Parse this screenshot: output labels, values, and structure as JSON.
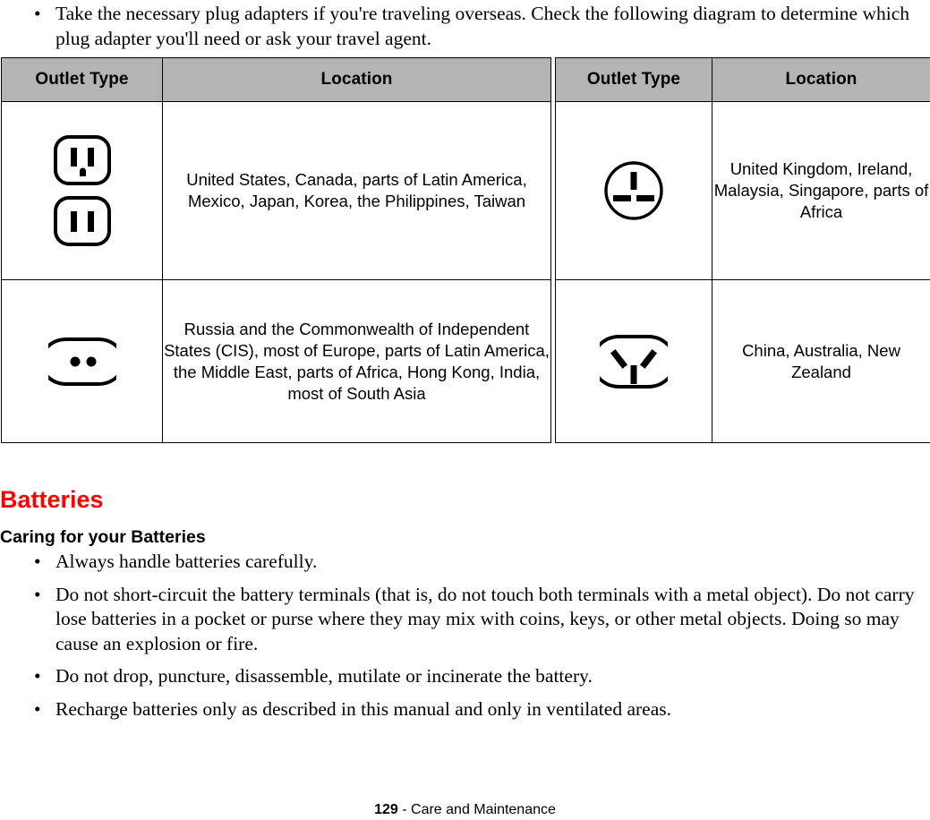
{
  "intro": {
    "bullets": [
      "Take the necessary plug adapters if you're traveling overseas. Check the following diagram to determine which plug adapter you'll need or ask your travel agent."
    ]
  },
  "outlet_table_left": {
    "headers": [
      "Outlet Type",
      "Location"
    ],
    "rows": [
      {
        "icon": "us-outlet-icon",
        "location": "United States, Canada, parts of Latin America, Mexico, Japan, Korea, the Philippines, Taiwan"
      },
      {
        "icon": "europlug-outlet-icon",
        "location": "Russia and the Commonwealth of Independent States (CIS), most of Europe, parts of Latin America, the Middle East, parts of Africa, Hong Kong, India, most of South Asia"
      }
    ]
  },
  "outlet_table_right": {
    "headers": [
      "Outlet Type",
      "Location"
    ],
    "rows": [
      {
        "icon": "uk-outlet-icon",
        "location": "United Kingdom, Ireland, Malaysia, Singapore, parts of Africa"
      },
      {
        "icon": "au-outlet-icon",
        "location": "China, Australia, New Zealand"
      }
    ]
  },
  "batteries": {
    "heading": "Batteries",
    "subheading": "Caring for your Batteries",
    "bullets": [
      "Always handle batteries carefully.",
      "Do not short-circuit the battery terminals (that is, do not touch both terminals with a metal object). Do not carry lose batteries in a pocket or purse where they may mix with coins, keys, or other metal objects. Doing so may cause an explosion or fire.",
      "Do not drop, puncture, disassemble, mutilate or incinerate the battery.",
      "Recharge batteries only as described in this manual and only in ventilated areas."
    ]
  },
  "footer": {
    "page_number": "129",
    "separator": " - ",
    "section": "Care and Maintenance"
  },
  "colors": {
    "heading_red": "#ff0000",
    "table_header_gray": "#b4b4b4",
    "rule_black": "#000000"
  },
  "bullet_glyph": "•"
}
